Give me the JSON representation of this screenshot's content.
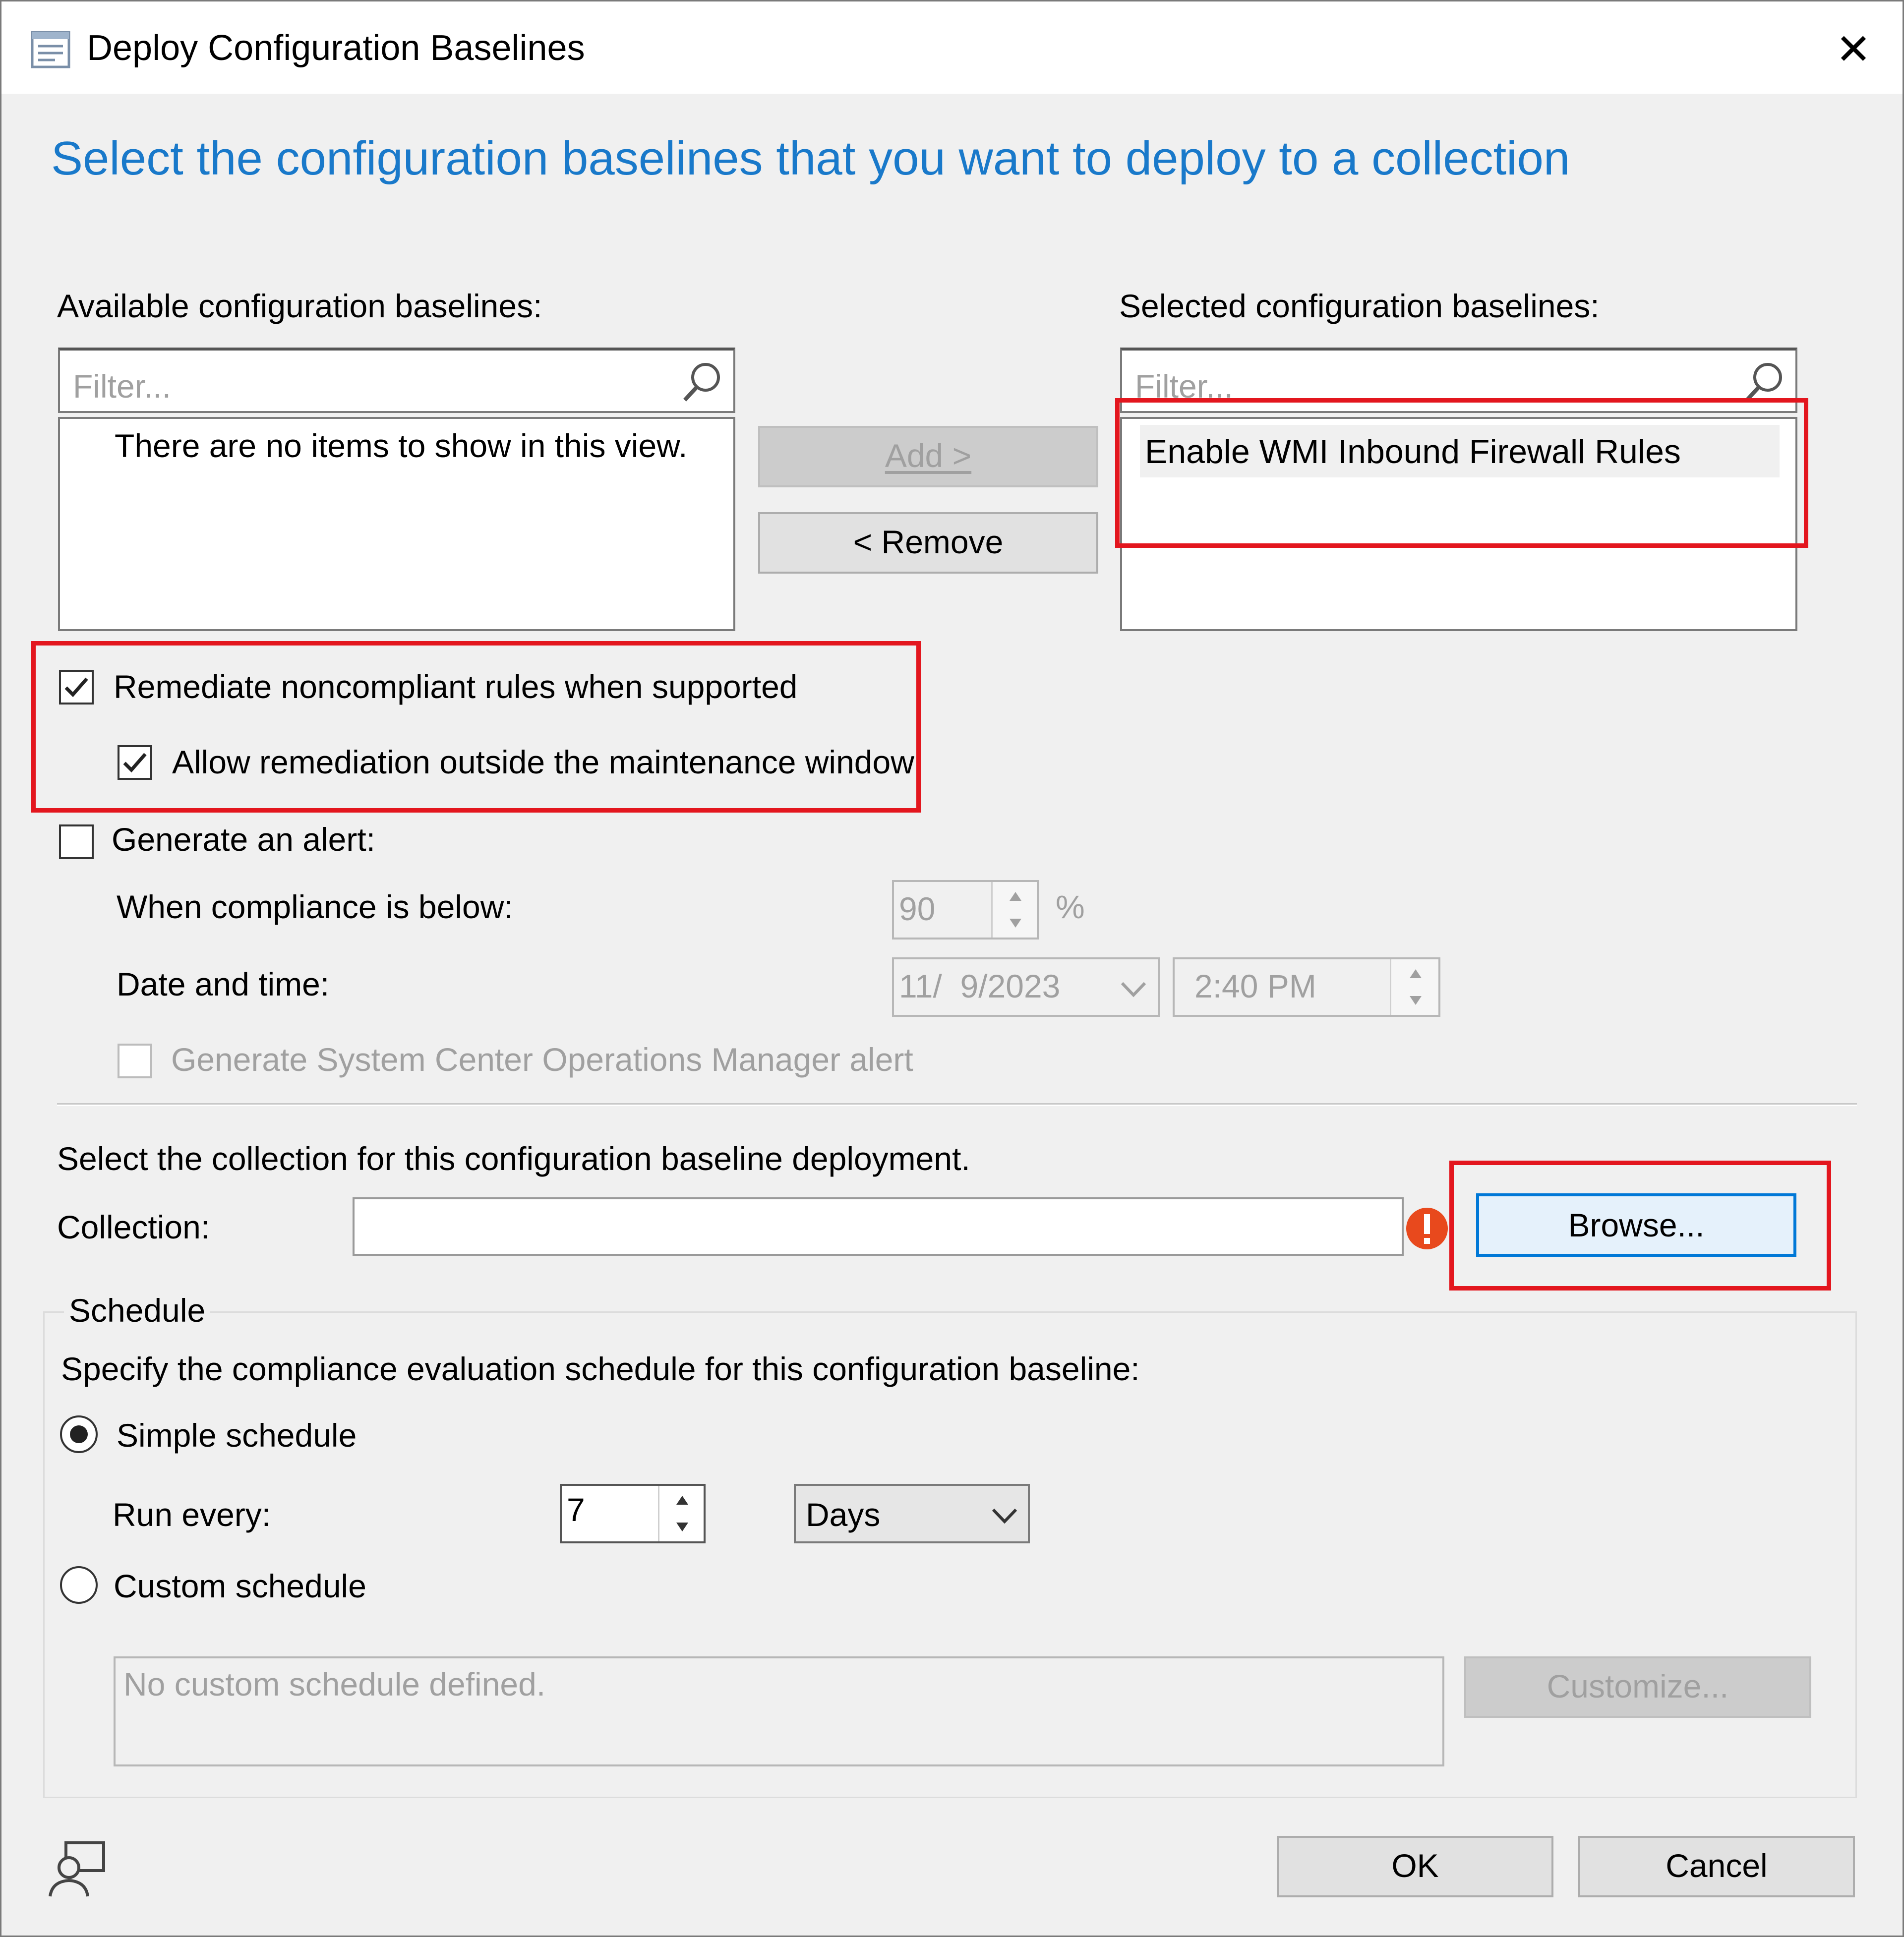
{
  "window": {
    "title": "Deploy Configuration Baselines",
    "close_glyph": "✕"
  },
  "heading": "Select the configuration baselines that you want to deploy to a collection",
  "available": {
    "label": "Available configuration baselines:",
    "filter_placeholder": "Filter...",
    "empty_text": "There are no items to show in this view."
  },
  "selected": {
    "label": "Selected configuration baselines:",
    "filter_placeholder": "Filter...",
    "items": [
      "Enable WMI Inbound Firewall Rules"
    ]
  },
  "buttons": {
    "add": "Add >",
    "remove": "< Remove",
    "browse": "Browse...",
    "customize": "Customize...",
    "ok": "OK",
    "cancel": "Cancel"
  },
  "remediation": {
    "remediate_label": "Remediate noncompliant rules when supported",
    "remediate_checked": true,
    "outside_window_label": "Allow remediation outside the maintenance window",
    "outside_window_checked": true
  },
  "alert": {
    "generate_label": "Generate an alert:",
    "generate_checked": false,
    "compliance_label": "When compliance is below:",
    "compliance_value": "90",
    "percent": "%",
    "datetime_label": "Date and time:",
    "date_value": "11/  9/2023",
    "time_value": "2:40 PM",
    "scom_label": "Generate System Center Operations Manager alert",
    "scom_checked": false
  },
  "collection": {
    "instruction": "Select the collection for this configuration baseline deployment.",
    "label": "Collection:",
    "value": ""
  },
  "schedule": {
    "group_title": "Schedule",
    "instruction": "Specify the compliance evaluation schedule for this configuration baseline:",
    "simple_label": "Simple schedule",
    "simple_selected": true,
    "run_every_label": "Run every:",
    "run_every_value": "7",
    "unit_value": "Days",
    "custom_label": "Custom schedule",
    "custom_selected": false,
    "custom_text": "No custom schedule defined."
  },
  "colors": {
    "heading_blue": "#1979ca",
    "highlight_red": "#e3161e",
    "focus_blue": "#0078d7",
    "error_orange": "#e8491d"
  }
}
